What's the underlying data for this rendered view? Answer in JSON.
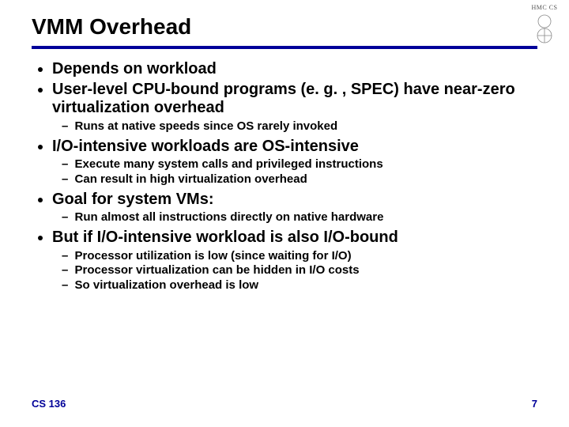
{
  "title": "VMM Overhead",
  "bullets": [
    {
      "text": "Depends on workload",
      "subs": []
    },
    {
      "text": "User-level CPU-bound programs (e. g. , SPEC) have near-zero virtualization overhead",
      "subs": [
        "Runs at native speeds since OS rarely invoked"
      ]
    },
    {
      "text": "I/O-intensive workloads are OS-intensive",
      "subs": [
        "Execute many system calls and privileged instructions",
        "Can result in high virtualization overhead"
      ]
    },
    {
      "text": "Goal for system VMs:",
      "subs": [
        "Run almost all instructions directly on native hardware"
      ]
    },
    {
      "text": "But if I/O-intensive workload is also I/O-bound",
      "subs": [
        "Processor utilization is low (since waiting for I/O)",
        "Processor virtualization can be hidden in I/O costs",
        "So virtualization overhead is low"
      ]
    }
  ],
  "footer": {
    "left": "CS 136",
    "right": "7"
  },
  "logo_text": "HMC CS"
}
